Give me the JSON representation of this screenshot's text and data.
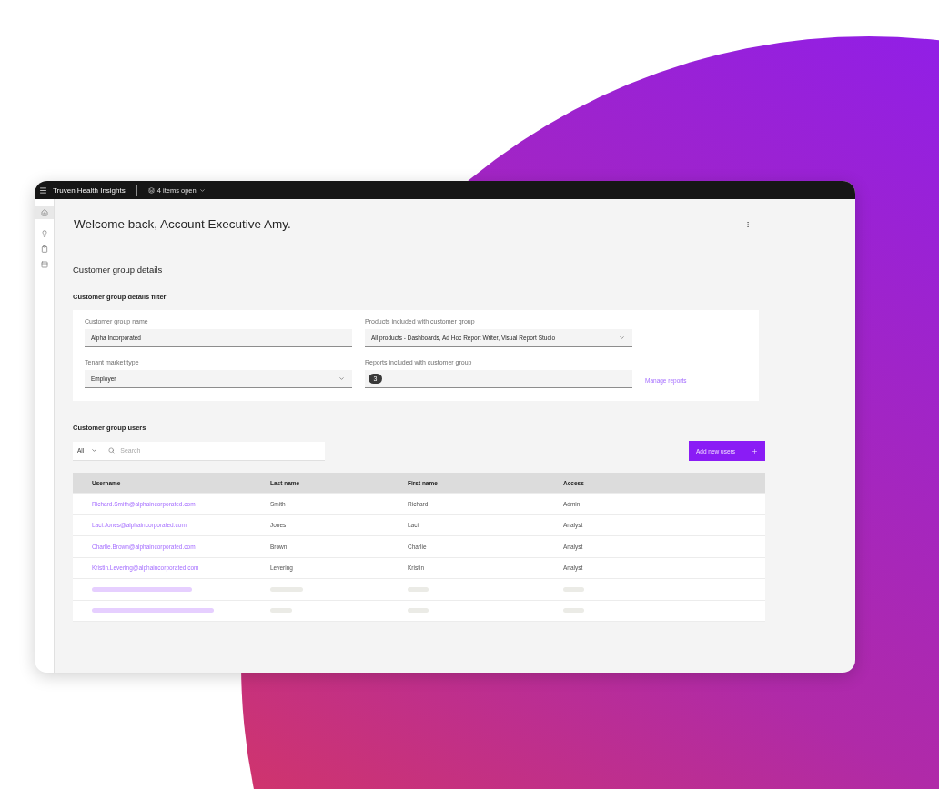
{
  "topbar": {
    "app_name": "Truven Health Insights",
    "open_items": "4 items open"
  },
  "sidebar": {
    "items": [
      {
        "selected": true
      },
      {
        "selected": false
      },
      {
        "selected": false
      },
      {
        "selected": false
      }
    ]
  },
  "welcome": "Welcome back, Account Executive Amy.",
  "section_title": "Customer group details",
  "filter": {
    "title": "Customer group details filter",
    "fields": [
      {
        "kind": "text",
        "label": "Customer group name",
        "value": "Alpha Incorporated"
      },
      {
        "kind": "select",
        "label": "Products included with customer group",
        "value": "All products - Dashboards, Ad Hoc Report Writer, Visual Report Studio"
      },
      {
        "kind": "select",
        "label": "Tenant market type",
        "value": "Employer"
      },
      {
        "kind": "chips",
        "label": "Reports included with customer group",
        "count": "3",
        "link": "Manage reports"
      }
    ]
  },
  "users": {
    "title": "Customer group users",
    "scope": "All",
    "search_placeholder": "Search",
    "add_button": "Add new users",
    "columns": [
      "Username",
      "Last name",
      "First name",
      "Access"
    ],
    "rows": [
      {
        "kind": "user",
        "cells": [
          "Richard.Smith@alphaincorporated.com",
          "Smith",
          "Richard",
          "Admin"
        ]
      },
      {
        "kind": "user",
        "cells": [
          "Laci.Jones@alphaincorporated.com",
          "Jones",
          "Laci",
          "Analyst"
        ]
      },
      {
        "kind": "user",
        "cells": [
          "Charlie.Brown@alphaincorporated.com",
          "Brown",
          "Charlie",
          "Analyst"
        ]
      },
      {
        "kind": "user",
        "cells": [
          "Kristin.Levering@alphaincorporated.com",
          "Levering",
          "Kristin",
          "Analyst"
        ]
      },
      {
        "kind": "placeholder"
      },
      {
        "kind": "placeholder"
      }
    ]
  }
}
